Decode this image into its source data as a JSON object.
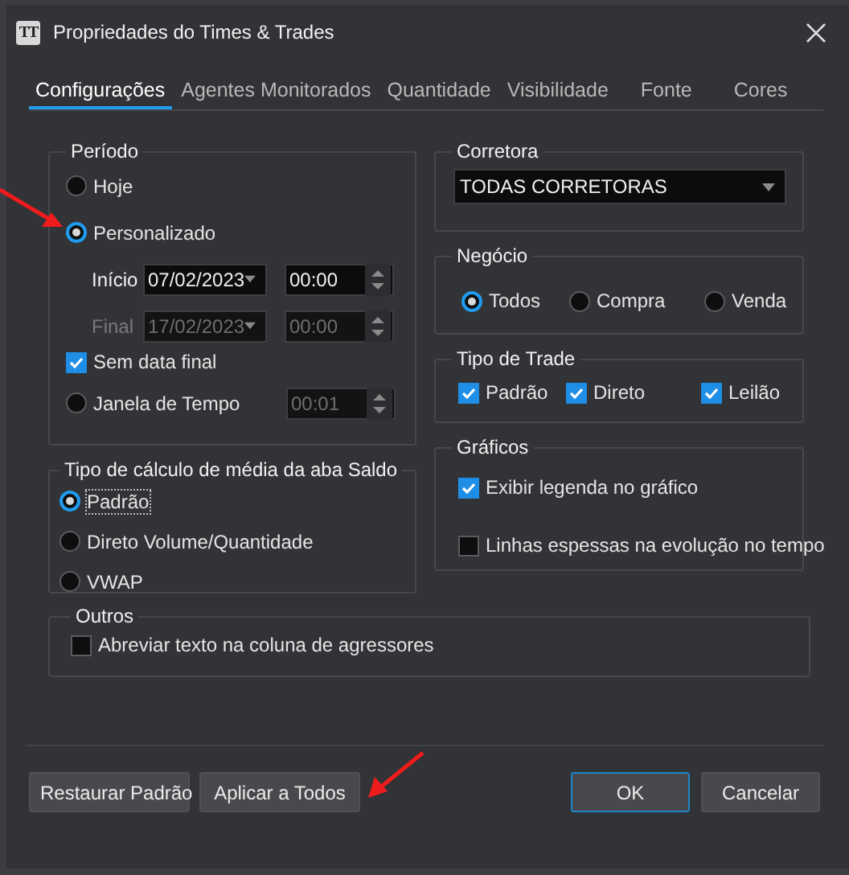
{
  "window": {
    "title": "Propriedades do Times & Trades",
    "logo": "TT"
  },
  "tabs": [
    {
      "label": "Configurações",
      "selected": true
    },
    {
      "label": "Agentes Monitorados",
      "selected": false
    },
    {
      "label": "Quantidade",
      "selected": false
    },
    {
      "label": "Visibilidade",
      "selected": false
    },
    {
      "label": "Fonte",
      "selected": false
    },
    {
      "label": "Cores",
      "selected": false
    }
  ],
  "periodo": {
    "title": "Período",
    "hoje": {
      "label": "Hoje",
      "selected": false
    },
    "personalizado": {
      "label": "Personalizado",
      "selected": true
    },
    "inicio": {
      "label": "Início",
      "date": "07/02/2023",
      "time": "00:00",
      "disabled": false
    },
    "final": {
      "label": "Final",
      "date": "17/02/2023",
      "time": "00:00",
      "disabled": true
    },
    "sem_data_final": {
      "label": "Sem data final",
      "checked": true
    },
    "janela": {
      "label": "Janela de Tempo",
      "selected": false,
      "time": "00:01",
      "disabled": true
    }
  },
  "corretora": {
    "title": "Corretora",
    "value": "TODAS CORRETORAS"
  },
  "negocio": {
    "title": "Negócio",
    "options": [
      {
        "label": "Todos",
        "selected": true
      },
      {
        "label": "Compra",
        "selected": false
      },
      {
        "label": "Venda",
        "selected": false
      }
    ]
  },
  "tipo_trade": {
    "title": "Tipo de Trade",
    "options": [
      {
        "label": "Padrão",
        "checked": true
      },
      {
        "label": "Direto",
        "checked": true
      },
      {
        "label": "Leilão",
        "checked": true
      }
    ]
  },
  "calculo": {
    "title": "Tipo de cálculo de média da aba Saldo",
    "options": [
      {
        "label": "Padrão",
        "selected": true,
        "focused": true
      },
      {
        "label": "Direto Volume/Quantidade",
        "selected": false,
        "focused": false
      },
      {
        "label": "VWAP",
        "selected": false,
        "focused": false
      }
    ]
  },
  "graficos": {
    "title": "Gráficos",
    "options": [
      {
        "label": "Exibir legenda no gráfico",
        "checked": true
      },
      {
        "label": "Linhas espessas na evolução no tempo",
        "checked": false
      }
    ]
  },
  "outros": {
    "title": "Outros",
    "options": [
      {
        "label": "Abreviar texto na coluna de agressores",
        "checked": false
      }
    ]
  },
  "buttons": [
    {
      "label": "Restaurar Padrão",
      "kind": "left",
      "default": false
    },
    {
      "label": "Aplicar a Todos",
      "kind": "left",
      "default": false
    },
    {
      "label": "OK",
      "kind": "right",
      "default": true
    },
    {
      "label": "Cancelar",
      "kind": "right",
      "default": false
    }
  ]
}
